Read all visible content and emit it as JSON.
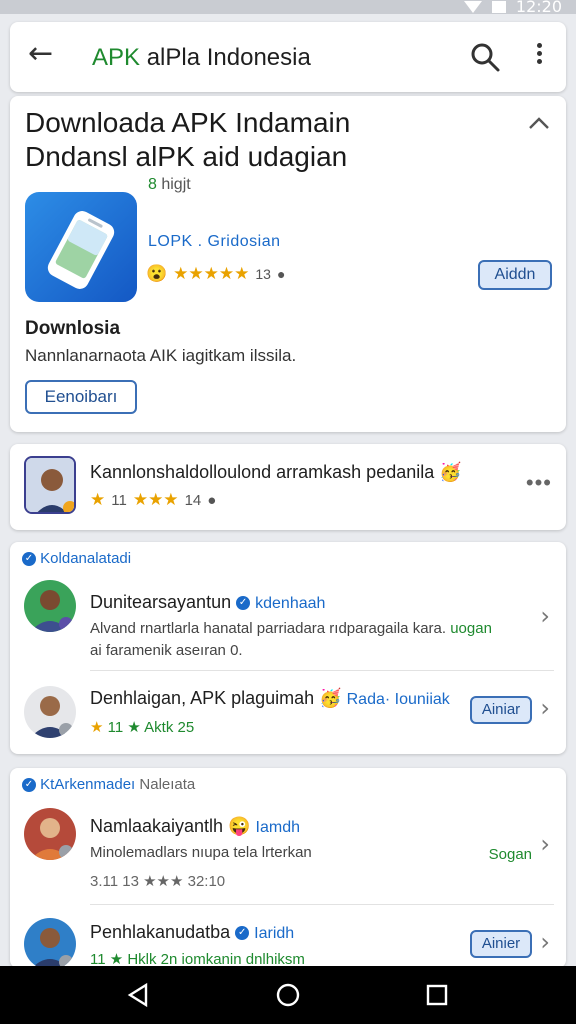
{
  "status": {
    "time": "12:20"
  },
  "appbar": {
    "title_green": "APK",
    "title_rest": " alPla Indonesia"
  },
  "main": {
    "heading_line1": "Downloada APK Indamain",
    "heading_line2": "Dndansl alPK aid udagian",
    "rank_num": "8",
    "rank_text": " higjt",
    "developer": "LOPK . Gridosian",
    "rating_count": "13",
    "stars": "★★★★★",
    "install_label": "Aiddn",
    "sub_title": "Downlosia",
    "description": "Nannlanarnaota AIK iagitkam ilssila.",
    "primary_label": "Eenoibarı"
  },
  "featured": {
    "name": "Kannlonshaldolloulond arramkash pedanila",
    "rating": "11",
    "stars": "★★★",
    "count": "14"
  },
  "section1": {
    "title": "Koldanalatadi",
    "items": [
      {
        "title": "Dunitearsayantun",
        "tag": "kdenhaah",
        "line1": "Alvand rnartlarla hanatal parriadara rıdparagaila kara.",
        "line1_green": "uogan",
        "line2": "ai faramenik aseıran 0."
      },
      {
        "title": "Denhlaigan, APK plaguimah",
        "tag": "Rada· Iouniiak",
        "meta": "11 ★ Aktk 25",
        "button": "Ainiar"
      }
    ]
  },
  "section2": {
    "title": "KtArkenmadeı",
    "title_gray": "Naleıata",
    "items": [
      {
        "title": "Namlaakaiyantlh",
        "tag": "Iamdh",
        "line1": "Minolemadlars nıupa tela lrterkan",
        "line1_green": "Sogan",
        "line2": "3.11 13 ★★★ 32:10"
      },
      {
        "title": "Penhlakanudatba",
        "tag": "Iaridh",
        "line1": "11 ★ Hklk 2n iomkanin dnlhiksm",
        "button": "Ainier"
      }
    ]
  },
  "colors": {
    "accent": "#1a6ac9",
    "green": "#1f8a2f",
    "star": "#e9a200"
  }
}
